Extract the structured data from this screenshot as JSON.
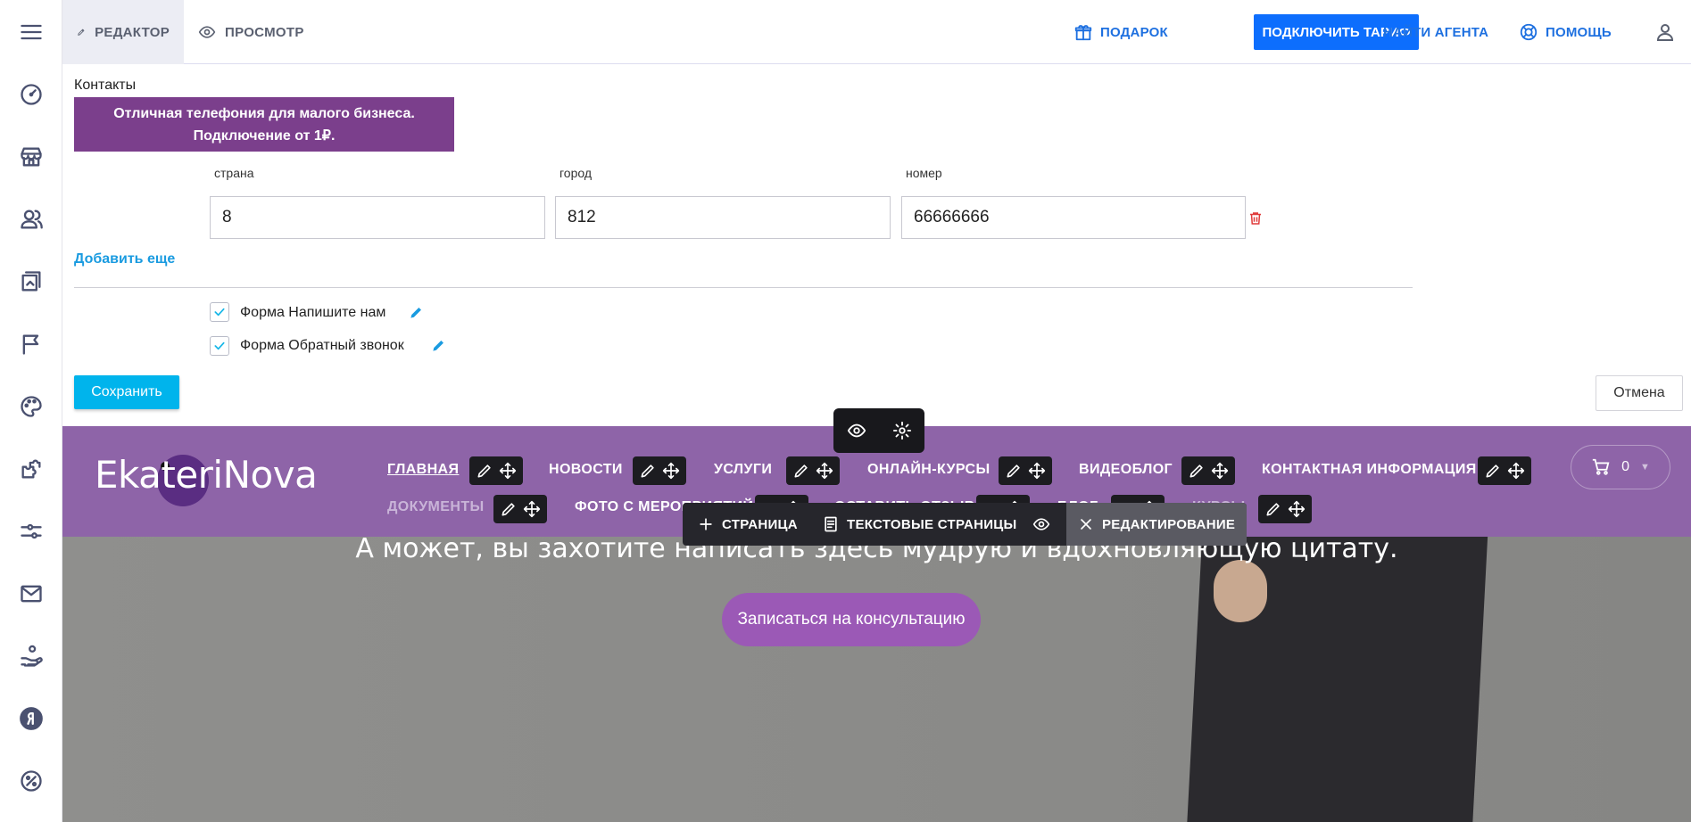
{
  "topbar": {
    "editor_tab": "РЕДАКТОР",
    "preview_tab": "ПРОСМОТР",
    "gift": "ПОДАРОК",
    "tariff": "ПОДКЛЮЧИТЬ ТАРИФ",
    "agent": "НАЙТИ АГЕНТА",
    "help": "ПОМОЩЬ"
  },
  "editor": {
    "title": "Контакты",
    "promo_line1": "Отличная телефония для малого бизнеса.",
    "promo_line2": "Подключение от 1₽.",
    "phone": {
      "country_label": "страна",
      "country_value": "8",
      "city_label": "город",
      "city_value": "812",
      "number_label": "номер",
      "number_value": "66666666"
    },
    "add_more": "Добавить еще",
    "forms": [
      {
        "label": "Форма Напишите нам",
        "checked": true
      },
      {
        "label": "Форма Обратный звонок",
        "checked": true
      }
    ],
    "save": "Сохранить",
    "cancel": "Отмена"
  },
  "site": {
    "logo": "EkateriNova",
    "nav_row1": [
      "ГЛАВНАЯ",
      "НОВОСТИ",
      "УСЛУГИ",
      "ОНЛАЙН-КУРСЫ",
      "ВИДЕОБЛОГ",
      "КОНТАКТНАЯ ИНФОРМАЦИЯ"
    ],
    "nav_row2": [
      "ДОКУМЕНТЫ",
      "ФОТО С МЕРОПРИЯТИЙ",
      "ОСТАВИТЬ ОТЗЫВ",
      "БЛОГ",
      "КУРСЫ"
    ],
    "cart_count": "0",
    "hero_quote": "А может, вы захотите написать здесь мудрую и вдохновляющую цитату.",
    "cta": "Записаться на консультацию"
  },
  "floatbar": {
    "page": "СТРАНИЦА",
    "text_pages": "ТЕКСТОВЫЕ СТРАНИЦЫ",
    "editing": "РЕДАКТИРОВАНИЕ"
  },
  "colors": {
    "accent": "#0d6efd",
    "save": "#00b4ec",
    "promo": "#7b3f8c",
    "nav": "#8e64a8",
    "cta": "#9b59b6"
  }
}
